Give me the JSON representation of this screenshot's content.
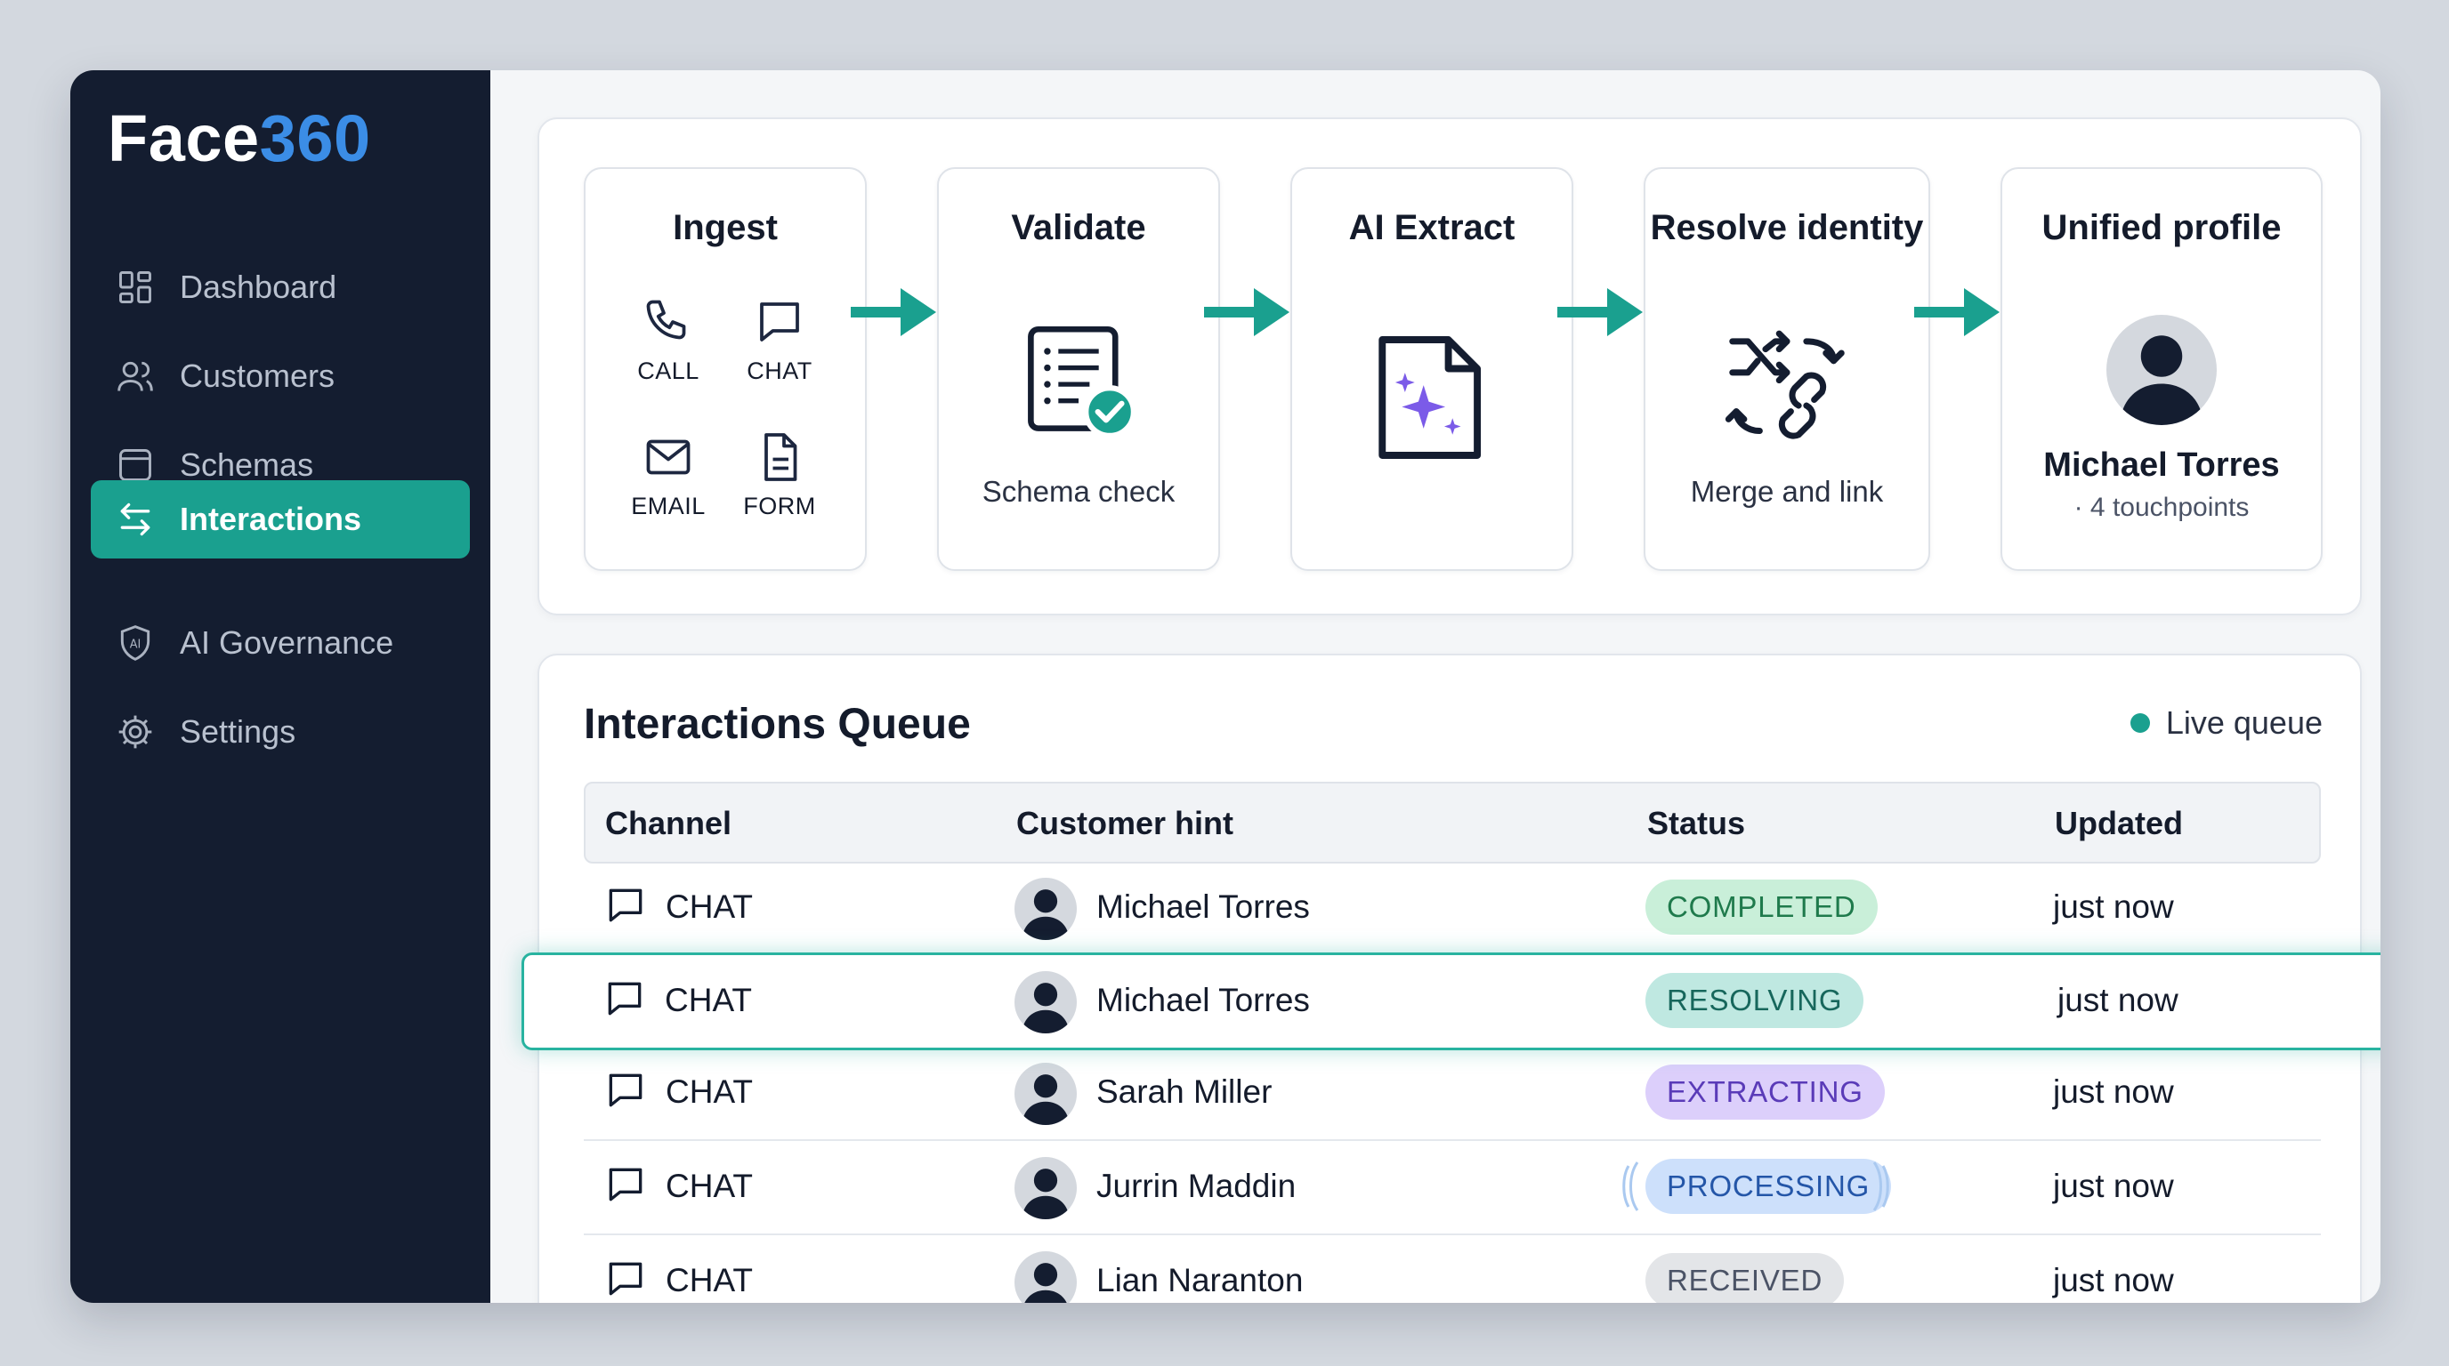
{
  "brand": {
    "name_part1": "Face",
    "name_part2": "360"
  },
  "sidebar": {
    "items": [
      {
        "label": "Dashboard",
        "icon": "dashboard-icon"
      },
      {
        "label": "Customers",
        "icon": "users-icon"
      },
      {
        "label": "Schemas",
        "icon": "schema-icon"
      },
      {
        "label": "Interactions",
        "icon": "swap-arrows-icon",
        "active": true
      },
      {
        "label": "AI Governance",
        "icon": "ai-shield-icon"
      },
      {
        "label": "Settings",
        "icon": "gear-icon"
      }
    ]
  },
  "pipeline": {
    "steps": [
      {
        "title": "Ingest",
        "channels": [
          "CALL",
          "CHAT",
          "EMAIL",
          "FORM"
        ]
      },
      {
        "title": "Validate",
        "subtitle": "Schema check"
      },
      {
        "title": "AI Extract"
      },
      {
        "title": "Resolve identity",
        "subtitle": "Merge and link"
      },
      {
        "title": "Unified profile",
        "name": "Michael Torres",
        "meta": "· 4 touchpoints"
      }
    ]
  },
  "queue": {
    "title": "Interactions Queue",
    "live_label": "Live queue",
    "columns": [
      "Channel",
      "Customer hint",
      "Status",
      "Updated"
    ],
    "rows": [
      {
        "channel": "CHAT",
        "customer": "Michael Torres",
        "status": "COMPLETED",
        "updated": "just now"
      },
      {
        "channel": "CHAT",
        "customer": "Michael Torres",
        "status": "RESOLVING",
        "updated": "just now"
      },
      {
        "channel": "CHAT",
        "customer": "Sarah Miller",
        "status": "EXTRACTING",
        "updated": "just now"
      },
      {
        "channel": "CHAT",
        "customer": "Jurrin Maddin",
        "status": "PROCESSING",
        "updated": "just now"
      },
      {
        "channel": "CHAT",
        "customer": "Lian Naranton",
        "status": "RECEIVED",
        "updated": "just now"
      }
    ]
  },
  "colors": {
    "accent": "#1aa08f",
    "brand_blue": "#3b8de6",
    "sidebar_bg": "#141d30",
    "completed": "#c9efd9",
    "resolving": "#bfe8e1",
    "extracting": "#dccffb",
    "processing": "#cde0fb",
    "received": "#e3e5e8"
  }
}
